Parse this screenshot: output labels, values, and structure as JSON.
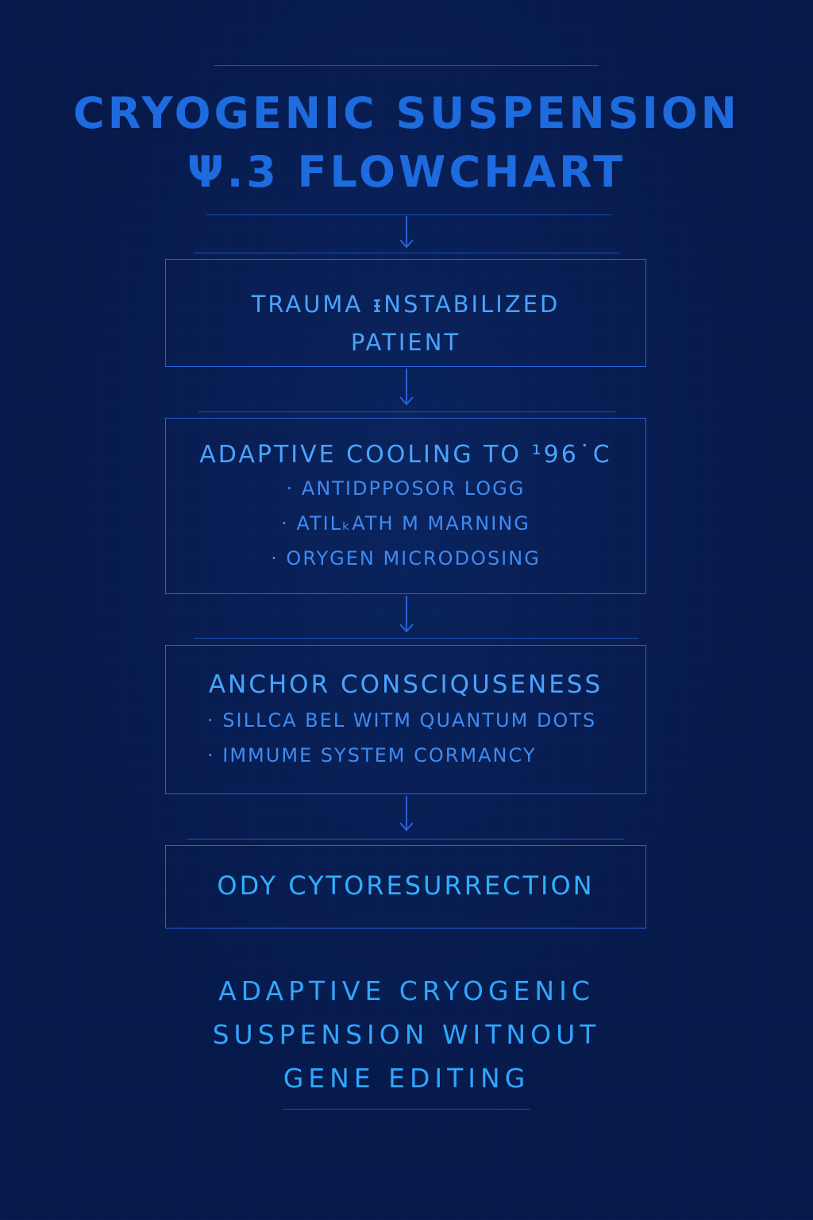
{
  "title": {
    "line1": "CRYOGENIC SUSPENSION",
    "line2": "Ψ.3 FLOWCHART"
  },
  "steps": [
    {
      "heading_lines": [
        "TRAUMA ᵻNSTABILIZED",
        "PATIENT"
      ],
      "bullets": []
    },
    {
      "heading_lines": [
        "ADAPTIVE COOLING TO  ¹96˙C"
      ],
      "bullets": [
        "· ANTIDPPOSOR LOGG",
        "· ATILₖATH M MARNING",
        "· ORYGEN MICRODOSING"
      ]
    },
    {
      "heading_lines": [
        "ANCHOR CONSCIQUSENESS"
      ],
      "bullets": [
        "· SILLCA BEL  WITM QUANTUM  DOTS",
        "· IMMUME SYSTEM  CORMANCY"
      ]
    },
    {
      "heading_lines": [
        "ODY CYTORESURRECTION"
      ],
      "bullets": []
    }
  ],
  "footer": {
    "line1": "ADAPTIVE CRYOGENIC",
    "line2": "SUSPENSION  WITNOUT",
    "line3": "GENE EDITING"
  },
  "colors": {
    "background": "#06194a",
    "title": "#1e6be0",
    "box_border": "#2a62d6",
    "text": "#3f8bf2",
    "footer_text": "#2fa6ff"
  },
  "icons": [
    "arrow-down-icon"
  ]
}
